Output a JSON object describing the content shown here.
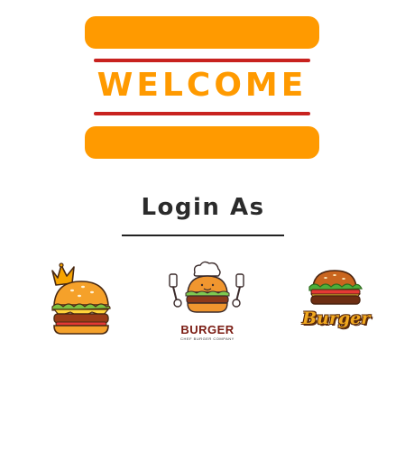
{
  "header": {
    "title": "WELCOME",
    "accent_color": "#ff9a00",
    "rule_color": "#c8221f"
  },
  "login": {
    "title": "Login As"
  },
  "options": [
    {
      "icon": "crowned-burger-icon"
    },
    {
      "icon": "chef-burger-icon",
      "brand": "BURGER",
      "tagline": "CHEF BURGER COMPANY"
    },
    {
      "icon": "burger-script-logo-icon",
      "brand": "Burger"
    }
  ]
}
